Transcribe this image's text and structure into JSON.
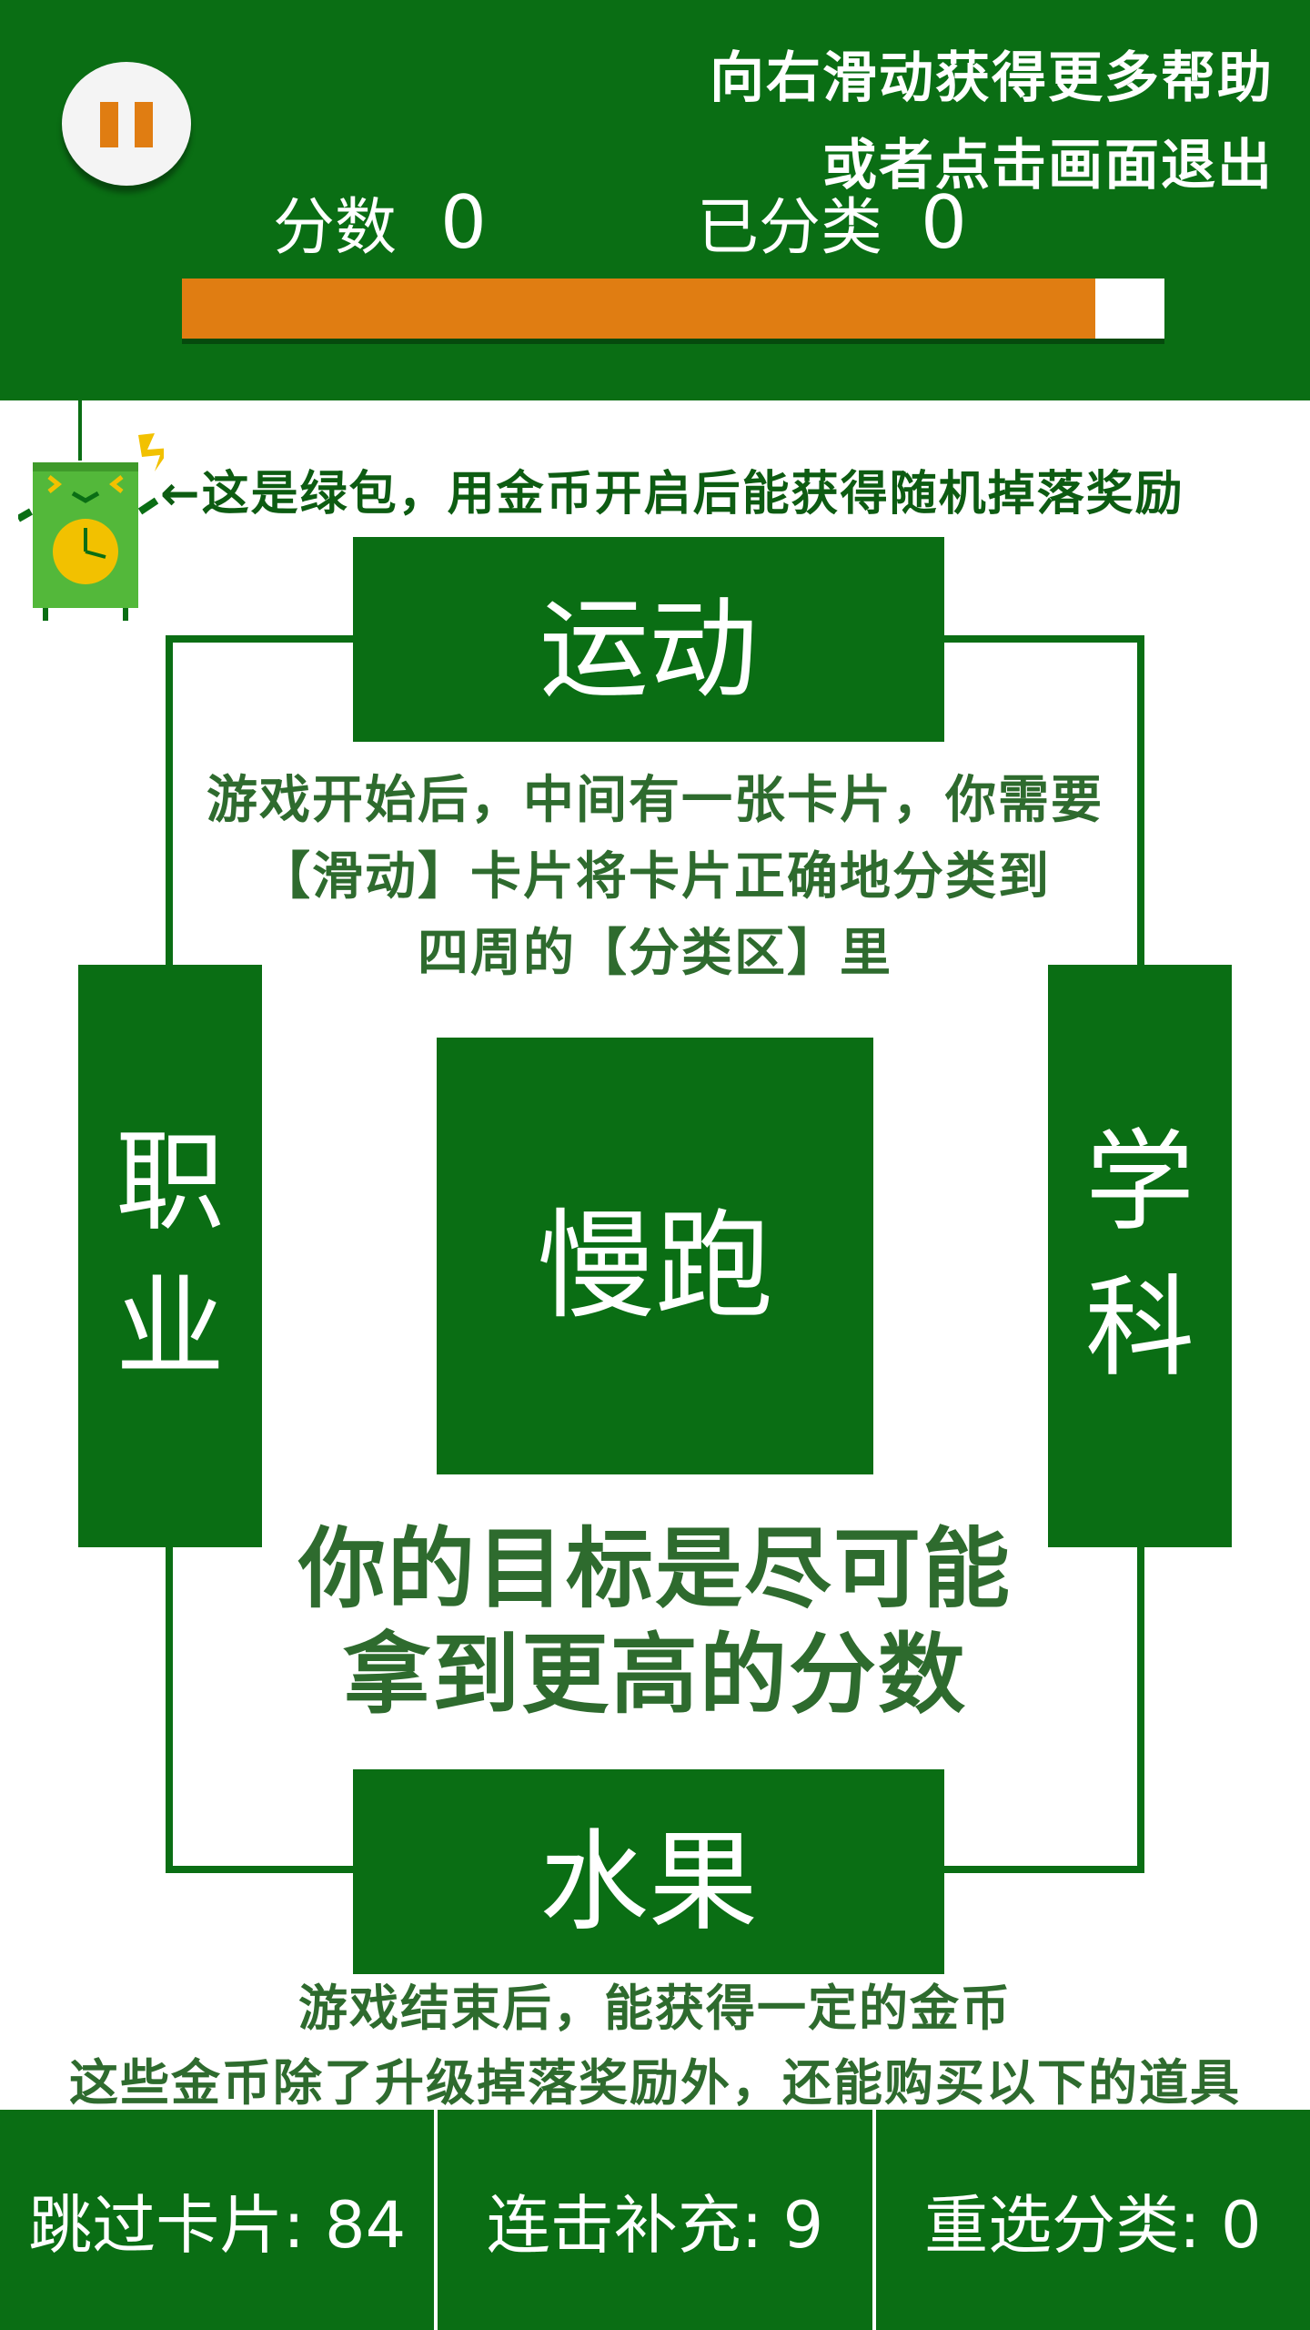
{
  "colors": {
    "header_bg": "#0a6e14",
    "accent_orange": "#e07d12",
    "text_green": "#2e6b2e",
    "white": "#ffffff"
  },
  "header": {
    "pause_icon": "pause-icon",
    "hint_lines": [
      "向右滑动获得更多帮助",
      "或者点击画面退出"
    ],
    "score_label": "分数",
    "score_value": "0",
    "classified_label": "已分类",
    "classified_value": "0",
    "timer_progress": 0.93
  },
  "bag": {
    "icon": "green-bag-clock-icon",
    "note": "←这是绿包，用金币开启后能获得随机掉落奖励"
  },
  "categories": {
    "top": "运动",
    "left": "职业",
    "right": "学科",
    "bottom": "水果"
  },
  "card": {
    "label": "慢跑"
  },
  "tips": {
    "swipe": [
      "游戏开始后，中间有一张卡片，你需要",
      "【滑动】卡片将卡片正确地分类到",
      "四周的【分类区】里"
    ],
    "goal": [
      "你的目标是尽可能",
      "拿到更高的分数"
    ],
    "coins": [
      "游戏结束后，能获得一定的金币",
      "这些金币除了升级掉落奖励外，还能购买以下的道具"
    ]
  },
  "items": [
    {
      "name": "跳过卡片",
      "count": "84",
      "text": "跳过卡片: 84"
    },
    {
      "name": "连击补充",
      "count": "9",
      "text": "连击补充: 9"
    },
    {
      "name": "重选分类",
      "count": "0",
      "text": "重选分类: 0"
    }
  ]
}
